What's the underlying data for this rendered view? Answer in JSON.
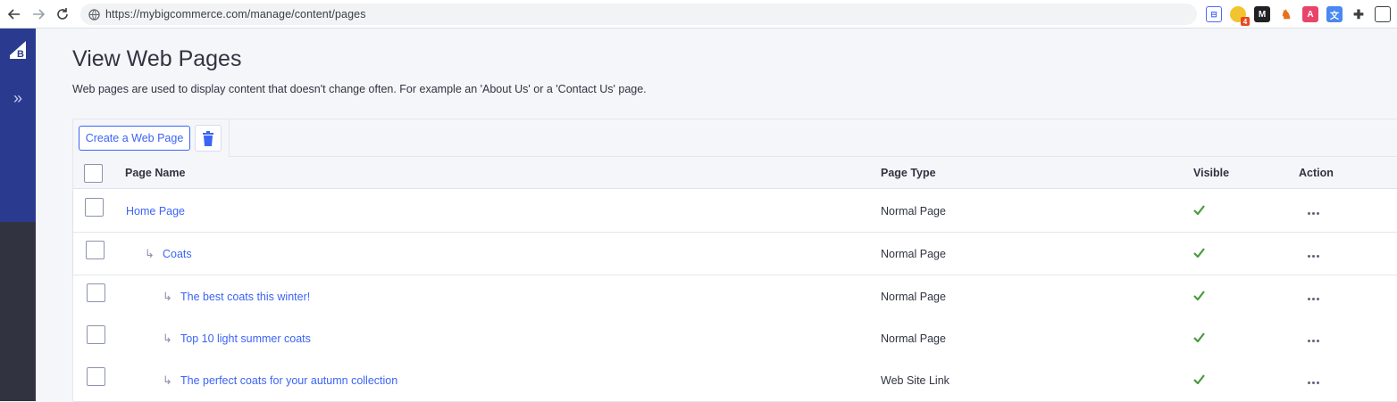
{
  "browser": {
    "url": "https://mybigcommerce.com/manage/content/pages",
    "extension_badge": "4"
  },
  "page": {
    "title": "View Web Pages",
    "description": "Web pages are used to display content that doesn't change often. For example an 'About Us' or a 'Contact Us' page."
  },
  "toolbar": {
    "create_label": "Create a Web Page"
  },
  "table": {
    "headers": {
      "page_name": "Page Name",
      "page_type": "Page Type",
      "visible": "Visible",
      "action": "Action"
    },
    "rows": [
      {
        "name": "Home Page",
        "type": "Normal Page",
        "depth": 0,
        "visible": true
      },
      {
        "name": "Coats",
        "type": "Normal Page",
        "depth": 1,
        "visible": true
      },
      {
        "name": "The best coats this winter!",
        "type": "Normal Page",
        "depth": 2,
        "visible": true
      },
      {
        "name": "Top 10 light summer coats",
        "type": "Normal Page",
        "depth": 2,
        "visible": true
      },
      {
        "name": "The perfect coats for your autumn collection",
        "type": "Web Site Link",
        "depth": 2,
        "visible": true
      }
    ]
  },
  "colors": {
    "accent": "#3c64f4",
    "sidebar": "#313440",
    "sidebar_top": "#2a3b8f",
    "check": "#4a9a3f"
  }
}
